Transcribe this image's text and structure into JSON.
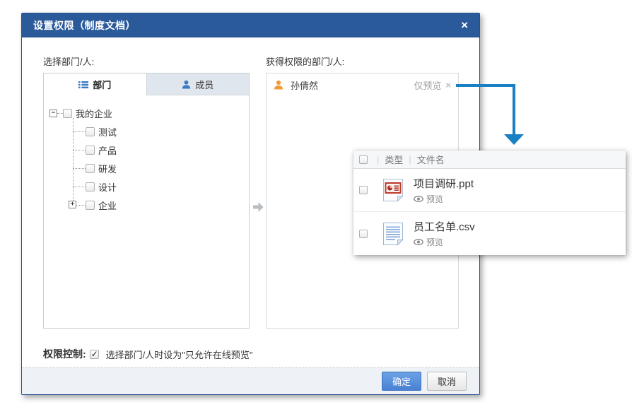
{
  "dialog": {
    "title": "设置权限（制度文档）",
    "close_glyph": "×",
    "left_label": "选择部门/人:",
    "right_label": "获得权限的部门/人:",
    "tabs": {
      "departments": "部门",
      "members": "成员"
    },
    "tree": {
      "collapse_glyph": "−",
      "expand_glyph": "+",
      "root": "我的企业",
      "children": [
        "测试",
        "产品",
        "研发",
        "设计",
        "企业"
      ]
    },
    "granted": {
      "name": "孙倩然",
      "permission": "仅预览",
      "remove_glyph": "×"
    },
    "footer": {
      "control_label": "权限控制:",
      "control_text": "选择部门/人时设为\"只允许在线预览\"",
      "control_checked": true,
      "ok": "确定",
      "cancel": "取消"
    }
  },
  "file_panel": {
    "col_sep": "|",
    "headers": {
      "type": "类型",
      "filename": "文件名"
    },
    "files": [
      {
        "name": "项目调研.ppt",
        "type": "ppt",
        "action": "预览"
      },
      {
        "name": "员工名单.csv",
        "type": "csv",
        "action": "预览"
      }
    ]
  },
  "colors": {
    "titlebar_blue": "#2b5a9b",
    "annotation_arrow_blue": "#1a80c4",
    "ok_button_blue": "#4a82d3",
    "person_orange": "#f19a37",
    "tab_icon_blue": "#3a79c3"
  }
}
